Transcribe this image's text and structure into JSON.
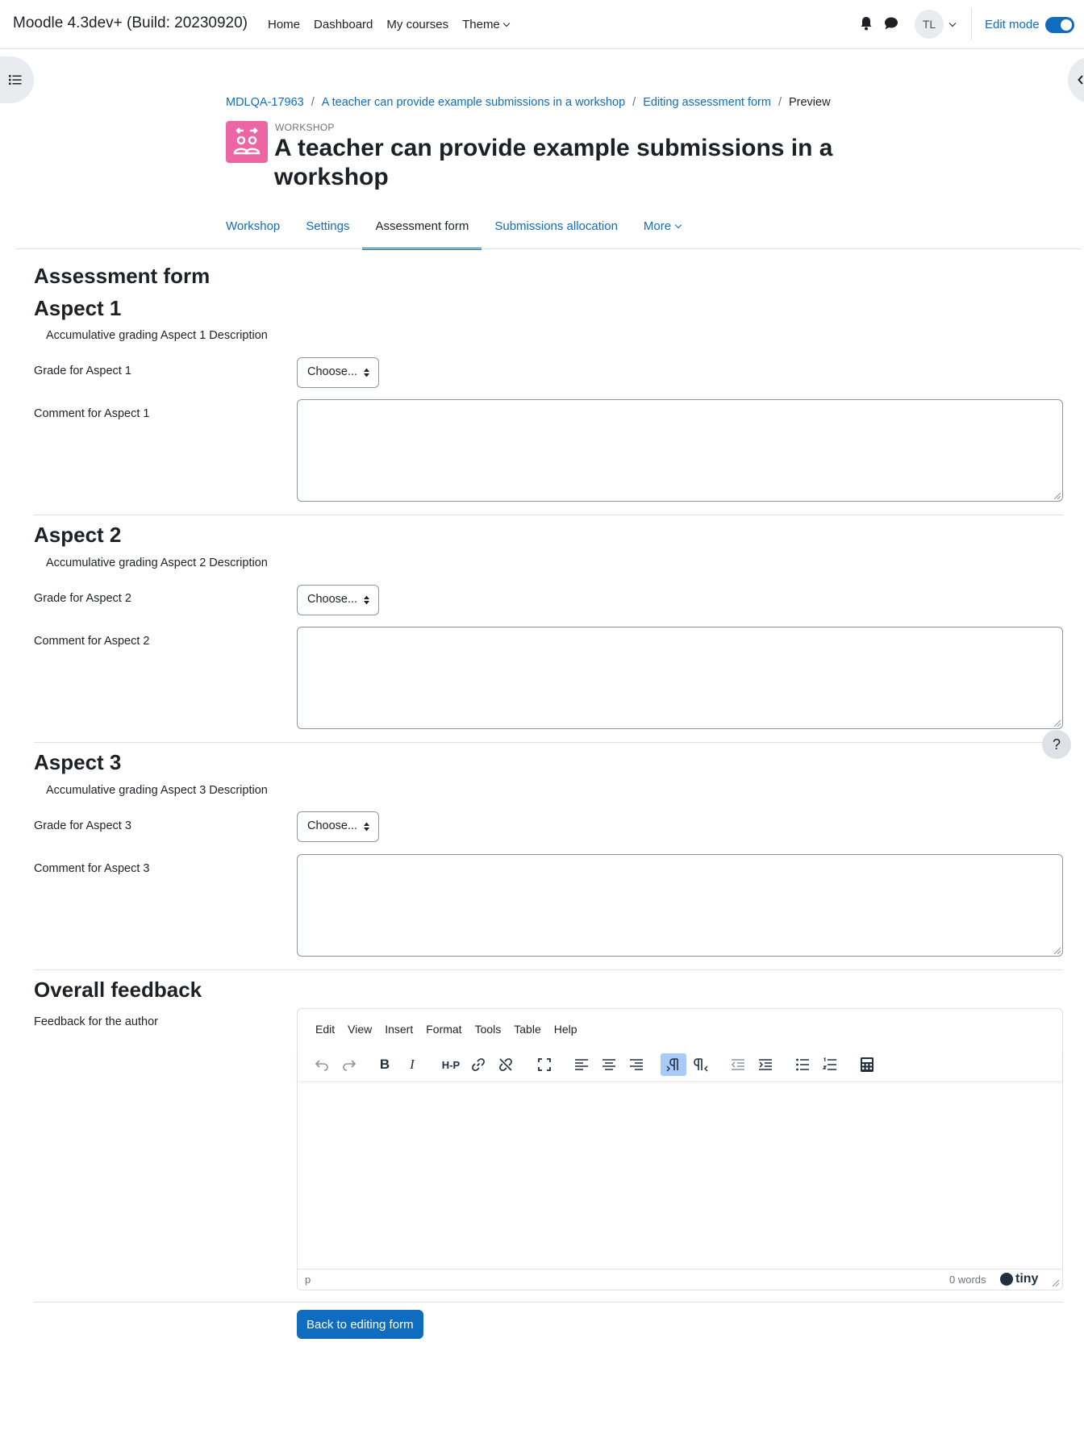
{
  "navbar": {
    "site_name": "Moodle 4.3dev+ (Build: 20230920)",
    "links": [
      "Home",
      "Dashboard",
      "My courses",
      "Theme"
    ],
    "avatar_initials": "TL",
    "edit_mode_label": "Edit mode",
    "edit_mode_on": true
  },
  "breadcrumb": [
    "MDLQA-17963",
    "A teacher can provide example submissions in a workshop",
    "Editing assessment form",
    "Preview"
  ],
  "header": {
    "module_type": "WORKSHOP",
    "title": "A teacher can provide example submissions in a workshop",
    "icon_color": "#eb66a2"
  },
  "tabs": {
    "workshop": "Workshop",
    "settings": "Settings",
    "assessment_form": "Assessment form",
    "submissions_allocation": "Submissions allocation",
    "more": "More"
  },
  "form": {
    "heading": "Assessment form",
    "aspects": [
      {
        "title": "Aspect 1",
        "description": "Accumulative grading Aspect 1 Description",
        "grade_label": "Grade for Aspect 1",
        "grade_value": "Choose...",
        "comment_label": "Comment for Aspect 1"
      },
      {
        "title": "Aspect 2",
        "description": "Accumulative grading Aspect 2 Description",
        "grade_label": "Grade for Aspect 2",
        "grade_value": "Choose...",
        "comment_label": "Comment for Aspect 2"
      },
      {
        "title": "Aspect 3",
        "description": "Accumulative grading Aspect 3 Description",
        "grade_label": "Grade for Aspect 3",
        "grade_value": "Choose...",
        "comment_label": "Comment for Aspect 3"
      }
    ],
    "overall_heading": "Overall feedback",
    "feedback_label": "Feedback for the author"
  },
  "editor": {
    "menus": [
      "Edit",
      "View",
      "Insert",
      "Format",
      "Tools",
      "Table",
      "Help"
    ],
    "toolbar_icons": [
      "undo-icon",
      "redo-icon",
      "bold-icon",
      "italic-icon",
      "h5p-icon",
      "link-icon",
      "unlink-icon",
      "fullscreen-icon",
      "align-left-icon",
      "align-center-icon",
      "align-right-icon",
      "ltr-icon",
      "rtl-icon",
      "outdent-icon",
      "indent-icon",
      "bullet-list-icon",
      "numbered-list-icon",
      "equation-icon"
    ],
    "bold_glyph": "B",
    "italic_glyph": "I",
    "h5p_glyph": "H-P",
    "status_path": "p",
    "word_count": "0 words",
    "brand": "tiny"
  },
  "help_glyph": "?",
  "back_button": "Back to editing form",
  "colors": {
    "accent": "#0f6cbf",
    "text": "#1d2125",
    "border": "#8f959e"
  }
}
